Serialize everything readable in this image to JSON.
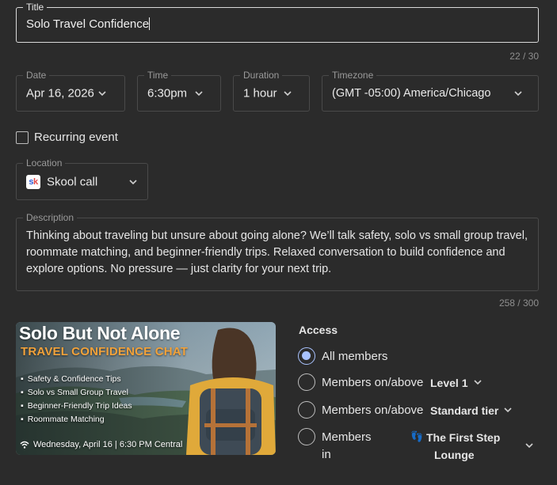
{
  "title_field": {
    "legend": "Title",
    "value": "Solo Travel Confidence",
    "counter": "22 / 30"
  },
  "date_field": {
    "legend": "Date",
    "value": "Apr 16, 2026"
  },
  "time_field": {
    "legend": "Time",
    "value": "6:30pm"
  },
  "duration_field": {
    "legend": "Duration",
    "value": "1 hour"
  },
  "timezone_field": {
    "legend": "Timezone",
    "value": "(GMT -05:00) America/Chicago"
  },
  "recurring": {
    "label": "Recurring event",
    "checked": false
  },
  "location_field": {
    "legend": "Location",
    "value": "Skool call",
    "logo": "sk"
  },
  "description_field": {
    "legend": "Description",
    "value": "Thinking about traveling but unsure about going alone? We’ll talk safety, solo vs small group travel, roommate matching, and beginner-friendly trips. Relaxed conversation to build confidence and explore options. No pressure — just clarity for your next trip.",
    "counter": "258 / 300"
  },
  "banner": {
    "title": "Solo But Not Alone",
    "subtitle": "TRAVEL CONFIDENCE CHAT",
    "items": [
      "Safety & Confidence Tips",
      "Solo vs Small Group Travel",
      "Beginner-Friendly Trip Ideas",
      "Roommate Matching"
    ],
    "footer": "Wednesday, April 16  |  6:30 PM Central"
  },
  "access": {
    "heading": "Access",
    "options": [
      {
        "label": "All members",
        "selected": true
      },
      {
        "label": "Members on/above",
        "value": "Level 1",
        "selected": false
      },
      {
        "label": "Members on/above",
        "value": "Standard tier",
        "selected": false
      },
      {
        "label_line1": "Members",
        "label_line2": "in",
        "value_line1": "The First Step",
        "value_line2": "Lounge",
        "emoji": "👣",
        "selected": false
      }
    ]
  },
  "colors": {
    "background": "#2b2b2b",
    "accent": "#a9c3ff",
    "banner_orange": "#f2a23a"
  }
}
